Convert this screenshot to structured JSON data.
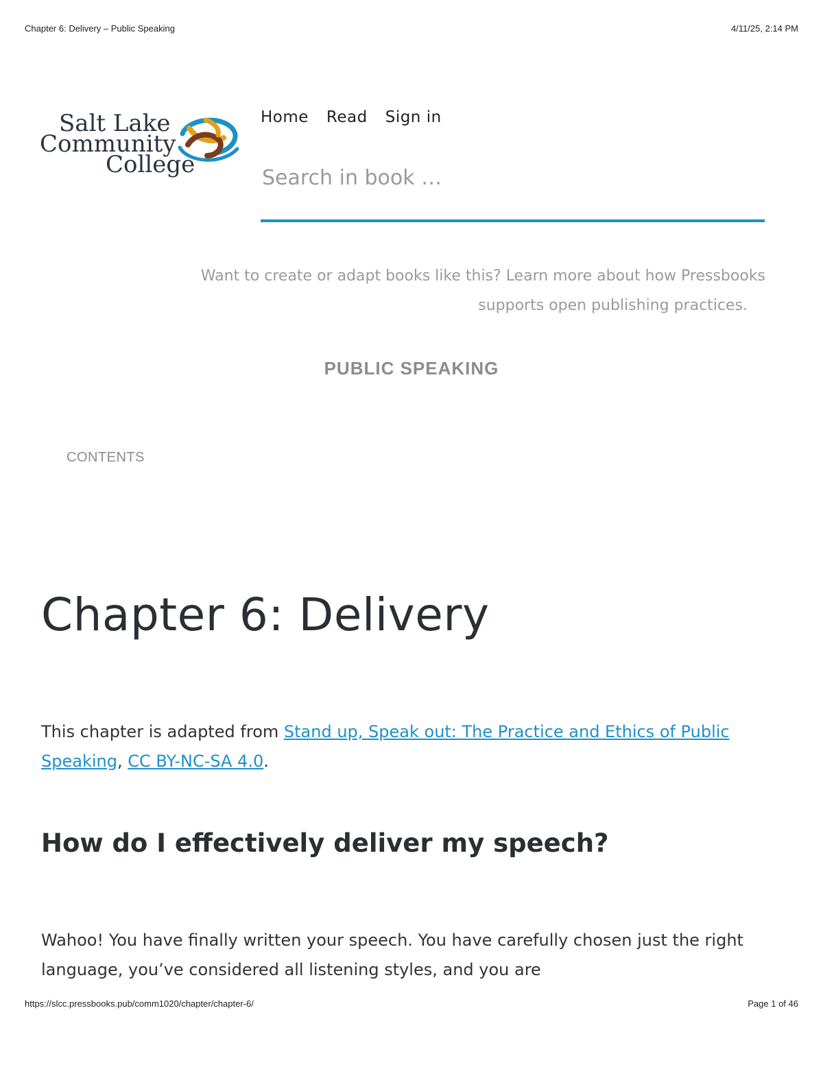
{
  "print_header": {
    "title": "Chapter 6: Delivery – Public Speaking",
    "timestamp": "4/11/25, 2:14 PM"
  },
  "print_footer": {
    "url": "https://slcc.pressbooks.pub/comm1020/chapter/chapter-6/",
    "page": "Page 1 of 46"
  },
  "logo": {
    "line1": "Salt Lake",
    "line2": "Community",
    "line3": "College",
    "colors": {
      "blue": "#1e90c8",
      "gold": "#e0a21c",
      "brown": "#7a3b1e",
      "navy": "#2c3340"
    }
  },
  "nav": {
    "home": "Home",
    "read": "Read",
    "sign_in": "Sign in"
  },
  "search": {
    "placeholder": "Search in book …"
  },
  "promo": {
    "line1": "Want to create or adapt books like this? Learn more about how Pressbooks",
    "line2": "supports open publishing practices."
  },
  "book_title": "PUBLIC SPEAKING",
  "contents_label": "CONTENTS",
  "chapter": {
    "title": "Chapter 6: Delivery",
    "attribution": {
      "prefix": "This chapter is adapted from ",
      "source_link": "Stand up, Speak out: The Practice and Ethics of Public Speaking",
      "separator": ", ",
      "license_link": "CC BY-NC-SA 4.0",
      "suffix": "."
    },
    "section_heading": "How do I effectively deliver my speech?",
    "paragraph": "Wahoo! You have finally written your speech. You have carefully chosen just the right language, you’ve considered all listening styles, and you are"
  },
  "accent_color": "#1e90c8"
}
